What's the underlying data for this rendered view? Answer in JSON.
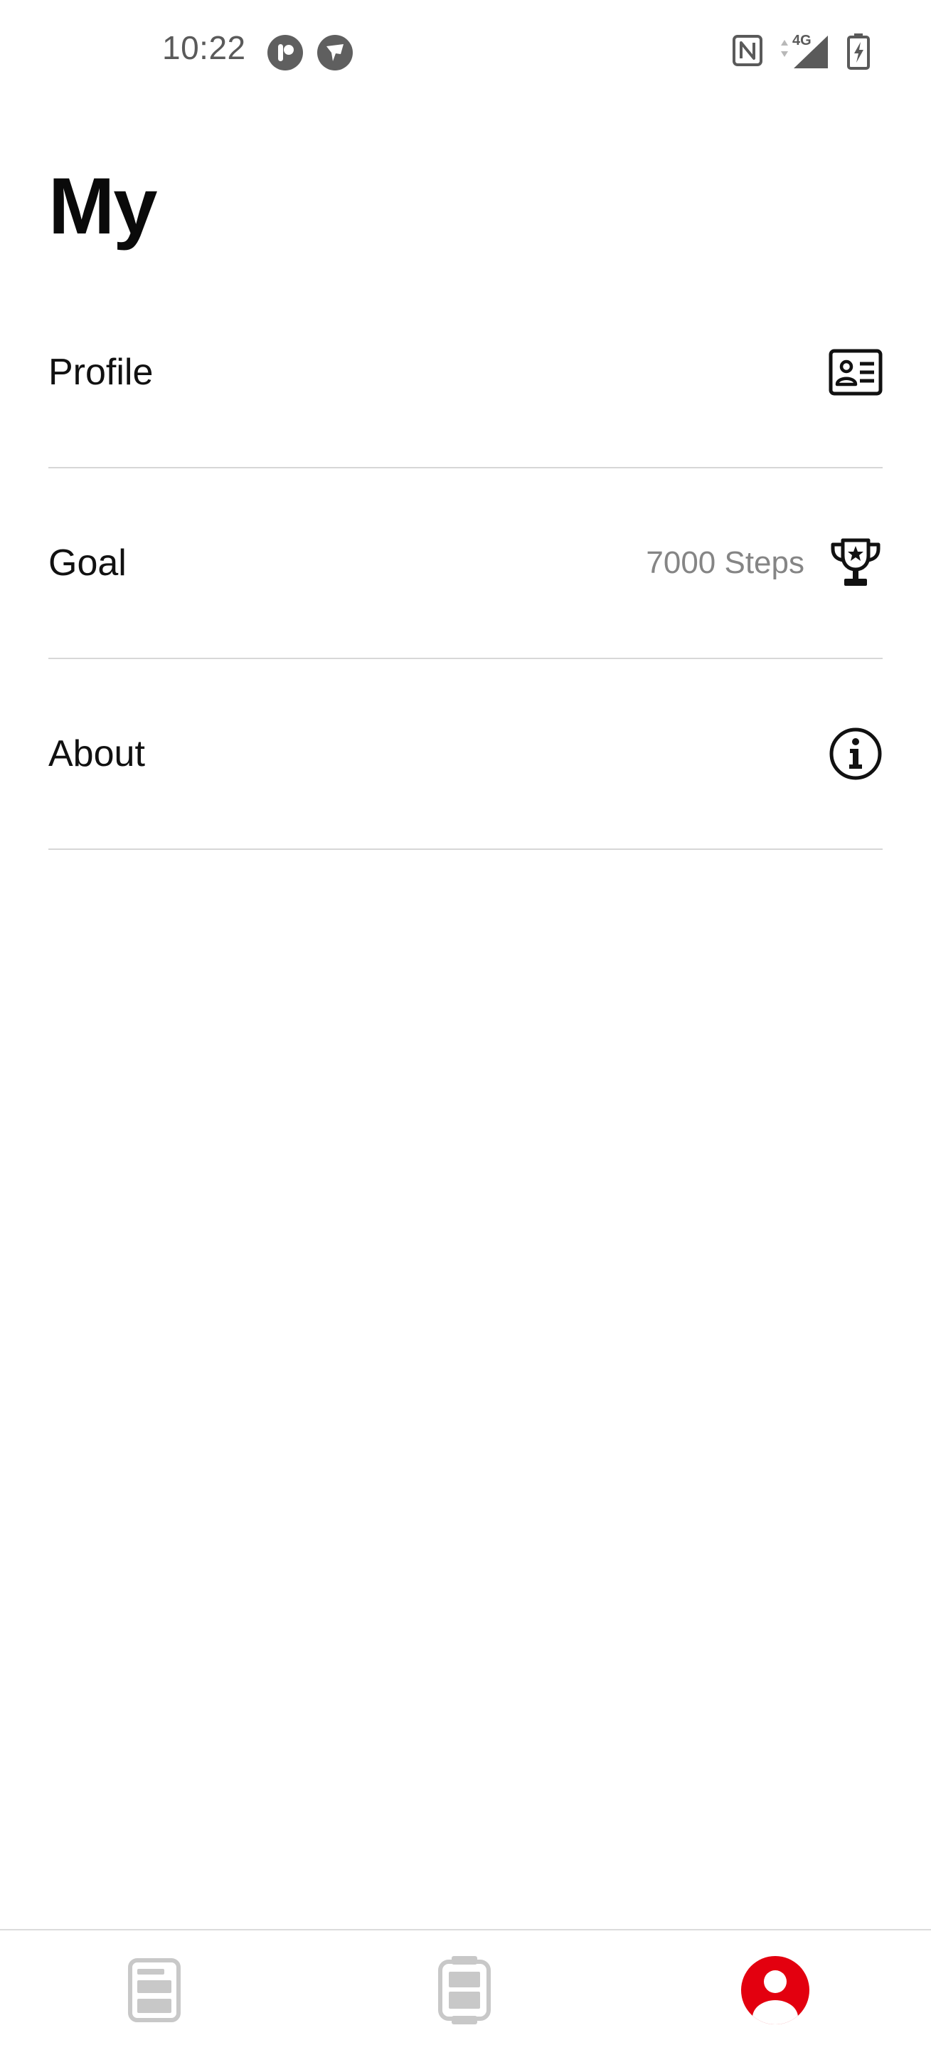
{
  "status_bar": {
    "time": "10:22",
    "network_label": "4G",
    "icons": [
      "app-notification-icon",
      "shield-notification-icon",
      "nfc-icon",
      "signal-icon",
      "battery-charging-icon"
    ]
  },
  "page": {
    "title": "My"
  },
  "menu": {
    "items": [
      {
        "label": "Profile",
        "value": "",
        "icon": "id-card-icon"
      },
      {
        "label": "Goal",
        "value": "7000 Steps",
        "icon": "trophy-icon"
      },
      {
        "label": "About",
        "value": "",
        "icon": "info-icon"
      }
    ]
  },
  "bottom_nav": {
    "items": [
      {
        "icon": "dashboard-icon",
        "active": false
      },
      {
        "icon": "watch-icon",
        "active": false
      },
      {
        "icon": "user-profile-icon",
        "active": true
      }
    ],
    "active_color": "#e3000f",
    "inactive_color": "#c8c8c8"
  },
  "colors": {
    "text": "#111111",
    "secondary_text": "#858585",
    "divider": "#d7d7d7",
    "accent": "#e3000f"
  }
}
